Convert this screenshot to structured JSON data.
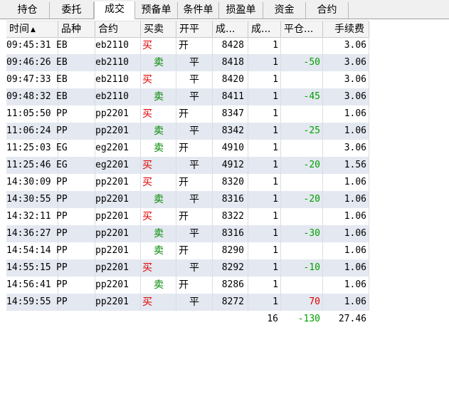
{
  "tabs": [
    {
      "label": "持仓",
      "active": false
    },
    {
      "label": "委托",
      "active": false
    },
    {
      "label": "成交",
      "active": true
    },
    {
      "label": "预备单",
      "active": false
    },
    {
      "label": "条件单",
      "active": false
    },
    {
      "label": "损盈单",
      "active": false
    },
    {
      "label": "资金",
      "active": false
    },
    {
      "label": "合约",
      "active": false
    }
  ],
  "columns": {
    "time": "时间",
    "product": "品种",
    "contract": "合约",
    "side": "买卖",
    "openclose": "开平",
    "price": "成...",
    "qty": "成...",
    "pnl": "平仓...",
    "fee": "手续费"
  },
  "sort_indicator": "▲",
  "rows": [
    {
      "time": "09:45:31",
      "product": "EB",
      "contract": "eb2110",
      "side": "买",
      "openclose": "开",
      "price": "8428",
      "qty": "1",
      "pnl": "",
      "fee": "3.06"
    },
    {
      "time": "09:46:26",
      "product": "EB",
      "contract": "eb2110",
      "side": "卖",
      "openclose": "平",
      "price": "8418",
      "qty": "1",
      "pnl": "-50",
      "fee": "3.06"
    },
    {
      "time": "09:47:33",
      "product": "EB",
      "contract": "eb2110",
      "side": "买",
      "openclose": "平",
      "price": "8420",
      "qty": "1",
      "pnl": "",
      "fee": "3.06"
    },
    {
      "time": "09:48:32",
      "product": "EB",
      "contract": "eb2110",
      "side": "卖",
      "openclose": "平",
      "price": "8411",
      "qty": "1",
      "pnl": "-45",
      "fee": "3.06"
    },
    {
      "time": "11:05:50",
      "product": "PP",
      "contract": "pp2201",
      "side": "买",
      "openclose": "开",
      "price": "8347",
      "qty": "1",
      "pnl": "",
      "fee": "1.06"
    },
    {
      "time": "11:06:24",
      "product": "PP",
      "contract": "pp2201",
      "side": "卖",
      "openclose": "平",
      "price": "8342",
      "qty": "1",
      "pnl": "-25",
      "fee": "1.06"
    },
    {
      "time": "11:25:03",
      "product": "EG",
      "contract": "eg2201",
      "side": "卖",
      "openclose": "开",
      "price": "4910",
      "qty": "1",
      "pnl": "",
      "fee": "3.06"
    },
    {
      "time": "11:25:46",
      "product": "EG",
      "contract": "eg2201",
      "side": "买",
      "openclose": "平",
      "price": "4912",
      "qty": "1",
      "pnl": "-20",
      "fee": "1.56"
    },
    {
      "time": "14:30:09",
      "product": "PP",
      "contract": "pp2201",
      "side": "买",
      "openclose": "开",
      "price": "8320",
      "qty": "1",
      "pnl": "",
      "fee": "1.06"
    },
    {
      "time": "14:30:55",
      "product": "PP",
      "contract": "pp2201",
      "side": "卖",
      "openclose": "平",
      "price": "8316",
      "qty": "1",
      "pnl": "-20",
      "fee": "1.06"
    },
    {
      "time": "14:32:11",
      "product": "PP",
      "contract": "pp2201",
      "side": "买",
      "openclose": "开",
      "price": "8322",
      "qty": "1",
      "pnl": "",
      "fee": "1.06"
    },
    {
      "time": "14:36:27",
      "product": "PP",
      "contract": "pp2201",
      "side": "卖",
      "openclose": "平",
      "price": "8316",
      "qty": "1",
      "pnl": "-30",
      "fee": "1.06"
    },
    {
      "time": "14:54:14",
      "product": "PP",
      "contract": "pp2201",
      "side": "卖",
      "openclose": "开",
      "price": "8290",
      "qty": "1",
      "pnl": "",
      "fee": "1.06"
    },
    {
      "time": "14:55:15",
      "product": "PP",
      "contract": "pp2201",
      "side": "买",
      "openclose": "平",
      "price": "8292",
      "qty": "1",
      "pnl": "-10",
      "fee": "1.06"
    },
    {
      "time": "14:56:41",
      "product": "PP",
      "contract": "pp2201",
      "side": "卖",
      "openclose": "开",
      "price": "8286",
      "qty": "1",
      "pnl": "",
      "fee": "1.06"
    },
    {
      "time": "14:59:55",
      "product": "PP",
      "contract": "pp2201",
      "side": "买",
      "openclose": "平",
      "price": "8272",
      "qty": "1",
      "pnl": "70",
      "fee": "1.06"
    }
  ],
  "totals": {
    "qty": "16",
    "pnl": "-130",
    "fee": "27.46"
  },
  "colors": {
    "buy": "#e00000",
    "sell": "#008800",
    "profit": "#e00000",
    "loss": "#00a000",
    "alt_row": "#e4e8f0"
  }
}
